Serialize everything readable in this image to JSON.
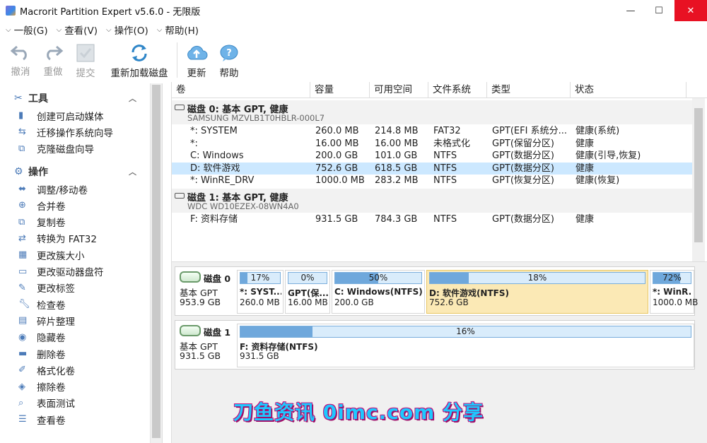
{
  "window": {
    "title": "Macrorit Partition Expert v5.6.0 - 无限版",
    "minimize": "—",
    "maximize": "☐",
    "close": "✕"
  },
  "menu": [
    {
      "label": "一般(G)"
    },
    {
      "label": "查看(V)"
    },
    {
      "label": "操作(O)"
    },
    {
      "label": "帮助(H)"
    }
  ],
  "toolbar": {
    "undo": "撤消",
    "redo": "重做",
    "commit": "提交",
    "reload": "重新加载磁盘",
    "update": "更新",
    "help": "帮助"
  },
  "sidebar": {
    "tools_title": "工具",
    "tools": [
      "创建可启动媒体",
      "迁移操作系统向导",
      "克隆磁盘向导"
    ],
    "ops_title": "操作",
    "ops": [
      "调整/移动卷",
      "合并卷",
      "复制卷",
      "转换为 FAT32",
      "更改簇大小",
      "更改驱动器盘符",
      "更改标签",
      "检查卷",
      "碎片整理",
      "隐藏卷",
      "删除卷",
      "格式化卷",
      "擦除卷",
      "表面测试",
      "查看卷"
    ]
  },
  "columns": [
    "卷",
    "容量",
    "可用空间",
    "文件系统",
    "类型",
    "状态"
  ],
  "disks": [
    {
      "title": "磁盘  0: 基本 GPT, 健康",
      "model": "SAMSUNG MZVLB1T0HBLR-000L7",
      "rows": [
        {
          "vol": "*: SYSTEM",
          "cap": "260.0 MB",
          "free": "214.8 MB",
          "fs": "FAT32",
          "type": "GPT(EFI 系统分...",
          "status": "健康(系统)"
        },
        {
          "vol": "*:",
          "cap": "16.00 MB",
          "free": "16.00 MB",
          "fs": "未格式化",
          "type": "GPT(保留分区)",
          "status": "健康"
        },
        {
          "vol": "C: Windows",
          "cap": "200.0 GB",
          "free": "101.0 GB",
          "fs": "NTFS",
          "type": "GPT(数据分区)",
          "status": "健康(引导,恢复)"
        },
        {
          "vol": "D: 软件游戏",
          "cap": "752.6 GB",
          "free": "618.5 GB",
          "fs": "NTFS",
          "type": "GPT(数据分区)",
          "status": "健康"
        },
        {
          "vol": "*: WinRE_DRV",
          "cap": "1000.0 MB",
          "free": "283.2 MB",
          "fs": "NTFS",
          "type": "GPT(恢复分区)",
          "status": "健康(恢复)"
        }
      ]
    },
    {
      "title": "磁盘  1: 基本 GPT, 健康",
      "model": "WDC WD10EZEX-08WN4A0",
      "rows": [
        {
          "vol": "F: 资料存储",
          "cap": "931.5 GB",
          "free": "784.3 GB",
          "fs": "NTFS",
          "type": "GPT(数据分区)",
          "status": "健康"
        }
      ]
    }
  ],
  "more_dots": ".....",
  "map": {
    "disk0": {
      "name": "磁盘 0",
      "type": "基本 GPT",
      "size": "953.9 GB",
      "parts": [
        {
          "pct": "17%",
          "fill": 0.17,
          "name": "*: SYST...",
          "size": "260.0 MB"
        },
        {
          "pct": "0%",
          "fill": 0.0,
          "name": "GPT(保...",
          "size": "16.00 MB"
        },
        {
          "pct": "50%",
          "fill": 0.5,
          "name": "C: Windows(NTFS)",
          "size": "200.0 GB"
        },
        {
          "pct": "18%",
          "fill": 0.18,
          "name": "D: 软件游戏(NTFS)",
          "size": "752.6 GB"
        },
        {
          "pct": "72%",
          "fill": 0.72,
          "name": "*: WinR...",
          "size": "1000.0 MB"
        }
      ]
    },
    "disk1": {
      "name": "磁盘 1",
      "type": "基本 GPT",
      "size": "931.5 GB",
      "parts": [
        {
          "pct": "16%",
          "fill": 0.16,
          "name": "F: 资料存储(NTFS)",
          "size": "931.5 GB"
        }
      ]
    }
  },
  "watermark": "刀鱼资讯 0imc.com 分享",
  "colors": {
    "selection": "#cce8ff",
    "selected_part": "#fbe9b5",
    "bar_fill": "#6fa8dc",
    "close": "#e81123"
  }
}
